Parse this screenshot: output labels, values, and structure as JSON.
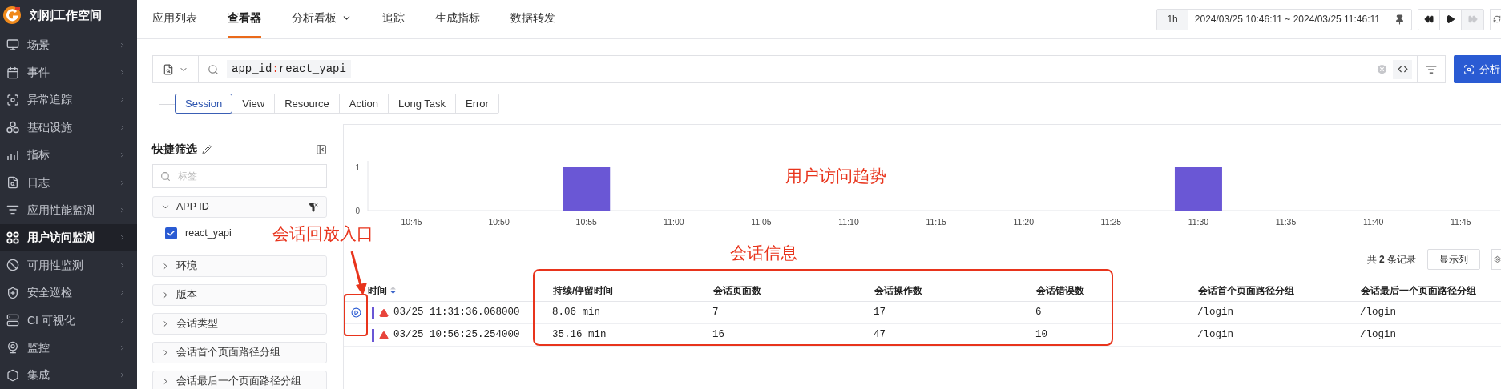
{
  "sidebar": {
    "workspace": "刘刚工作空间",
    "items": [
      {
        "label": "场景",
        "selected": false
      },
      {
        "label": "事件",
        "selected": false
      },
      {
        "label": "异常追踪",
        "selected": false
      },
      {
        "label": "基础设施",
        "selected": false
      },
      {
        "label": "指标",
        "selected": false
      },
      {
        "label": "日志",
        "selected": false
      },
      {
        "label": "应用性能监测",
        "selected": false
      },
      {
        "label": "用户访问监测",
        "selected": true
      },
      {
        "label": "可用性监测",
        "selected": false
      },
      {
        "label": "安全巡检",
        "selected": false
      },
      {
        "label": "CI 可视化",
        "selected": false
      },
      {
        "label": "监控",
        "selected": false
      },
      {
        "label": "集成",
        "selected": false
      }
    ]
  },
  "nav": {
    "tabs": [
      {
        "label": "应用列表",
        "selected": false,
        "dropdown": false
      },
      {
        "label": "查看器",
        "selected": true,
        "dropdown": false
      },
      {
        "label": "分析看板",
        "selected": false,
        "dropdown": true
      },
      {
        "label": "追踪",
        "selected": false,
        "dropdown": false
      },
      {
        "label": "生成指标",
        "selected": false,
        "dropdown": false
      },
      {
        "label": "数据转发",
        "selected": false,
        "dropdown": false
      }
    ]
  },
  "time_bar": {
    "range": "1h",
    "period": "2024/03/25 10:46:11 ~ 2024/03/25 11:46:11",
    "forward_disabled": true
  },
  "query": {
    "field": "app_id",
    "operator": ":",
    "value": "react_yapi"
  },
  "analyze_button": "分析",
  "data_types": [
    {
      "label": "Session",
      "selected": true
    },
    {
      "label": "View",
      "selected": false
    },
    {
      "label": "Resource",
      "selected": false
    },
    {
      "label": "Action",
      "selected": false
    },
    {
      "label": "Long Task",
      "selected": false
    },
    {
      "label": "Error",
      "selected": false
    }
  ],
  "quick_filter": {
    "title": "快捷筛选",
    "search_placeholder": "标签",
    "groups": [
      {
        "label": "APP ID",
        "expanded": true,
        "options": [
          {
            "label": "react_yapi",
            "checked": true
          }
        ]
      },
      {
        "label": "环境",
        "expanded": false
      },
      {
        "label": "版本",
        "expanded": false
      },
      {
        "label": "会话类型",
        "expanded": false
      },
      {
        "label": "会话首个页面路径分组",
        "expanded": false
      },
      {
        "label": "会话最后一个页面路径分组",
        "expanded": false
      }
    ]
  },
  "chart": {
    "chart_data": {
      "type": "bar",
      "categories": [
        "10:45",
        "10:50",
        "10:55",
        "11:00",
        "11:05",
        "11:10",
        "11:15",
        "11:20",
        "11:25",
        "11:30",
        "11:35",
        "11:40",
        "11:45"
      ],
      "values": [
        0,
        0,
        1,
        0,
        0,
        0,
        0,
        0,
        0,
        1,
        0,
        0,
        0
      ],
      "ylim": [
        0,
        1
      ],
      "yticks": [
        0,
        1
      ]
    }
  },
  "table": {
    "record_count": "共 **2** 条记录",
    "columns_button": "显示列",
    "columns": [
      "时间",
      "持续/停留时间",
      "会话页面数",
      "会话操作数",
      "会话错误数",
      "会话首个页面路径分组",
      "会话最后一个页面路径分组"
    ],
    "rows": [
      {
        "replay_button": true,
        "cells": [
          "03/25 11:31:36.068000",
          "8.06 min",
          "7",
          "17",
          "6",
          "/login",
          "/login"
        ]
      },
      {
        "replay_button": false,
        "cells": [
          "03/25 10:56:25.254000",
          "35.16 min",
          "16",
          "47",
          "10",
          "/login",
          "/login"
        ]
      }
    ]
  },
  "annotations": [
    {
      "kind": "callout",
      "text": "会话回放入口"
    },
    {
      "kind": "title",
      "text": "用户访问趋势"
    },
    {
      "kind": "frame",
      "text": "会话信息"
    }
  ]
}
